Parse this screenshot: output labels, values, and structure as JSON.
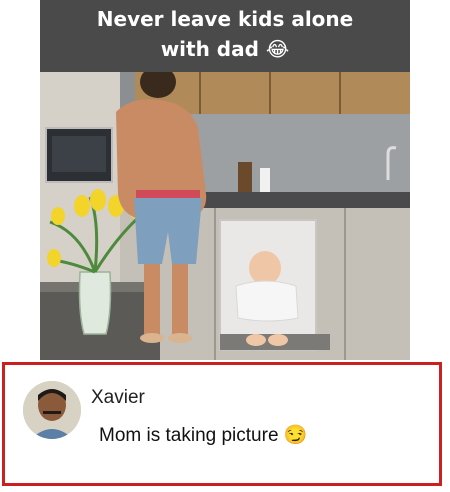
{
  "meme": {
    "caption_line1": "Never leave kids alone",
    "caption_line2": "with dad",
    "caption_emoji": "😂"
  },
  "comment": {
    "author": "Xavier",
    "text": "Mom is taking picture",
    "emoji": "😏"
  },
  "colors": {
    "caption_background": "#4a4a4a",
    "comment_border": "#cc1f1f"
  }
}
